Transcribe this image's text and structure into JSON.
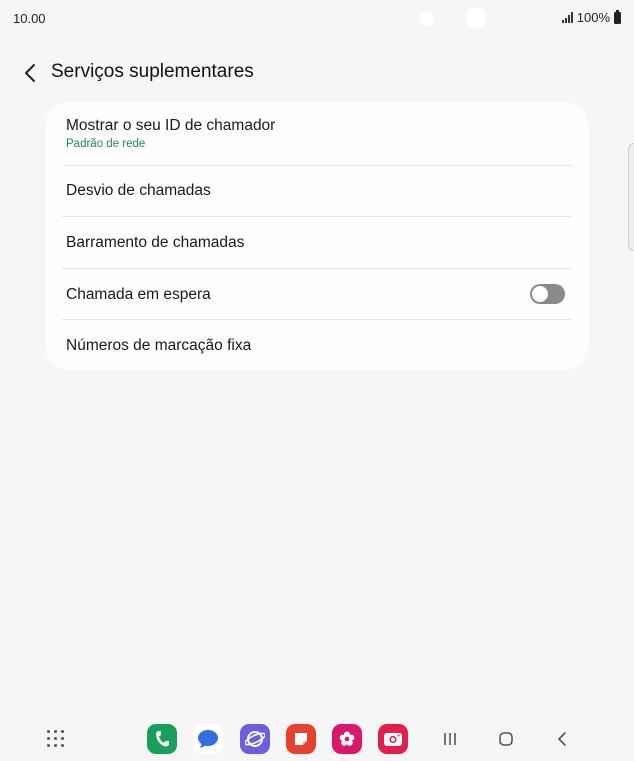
{
  "status_bar": {
    "time": "10.00",
    "battery": "100%"
  },
  "header": {
    "title": "Serviços suplementares"
  },
  "settings": {
    "caller_id": {
      "title": "Mostrar o seu ID de chamador",
      "subtitle": "Padrão de rede"
    },
    "call_forwarding": {
      "title": "Desvio de chamadas"
    },
    "call_barring": {
      "title": "Barramento de chamadas"
    },
    "call_waiting": {
      "title": "Chamada em espera",
      "enabled": false
    },
    "fixed_dialing": {
      "title": "Números de marcação fixa"
    }
  },
  "dock": {
    "apps": [
      "phone-icon",
      "messages-icon",
      "internet-icon",
      "notes-icon",
      "galaxy-store-icon",
      "camera-icon"
    ],
    "colors": {
      "phone": "#1a9e5c",
      "messages": "#2f6fe0",
      "internet": "#6b5fe0",
      "notes": "#e8402f",
      "store": "#d8196b",
      "camera": "#e0204a"
    }
  }
}
